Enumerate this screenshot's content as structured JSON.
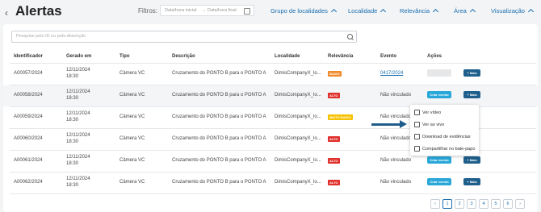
{
  "header": {
    "back_icon": "chevron-left-icon",
    "title": "Alertas",
    "filters_label": "Filtros:",
    "date_start_placeholder": "Data/hora inicial",
    "date_sep": "→",
    "date_end_placeholder": "Data/hora final",
    "filters": [
      "Grupo de localidades",
      "Localidade",
      "Relevância",
      "Área",
      "Visualização"
    ]
  },
  "search": {
    "placeholder": "Pesquise pelo ID ou pela descrição"
  },
  "table": {
    "columns": [
      "Identificador",
      "Gerado em",
      "Tipo",
      "Descrição",
      "Localidade",
      "Relevância",
      "Evento",
      "Ações"
    ],
    "rows": [
      {
        "id": "A00057/2024",
        "date": "12/11/2024",
        "time": "18:30",
        "type": "Câmera VC",
        "desc": "Cruzamento do PONTO B para o PONTO A",
        "loc": "DimisCompanyX_lo...",
        "rel": "BAIXO",
        "event": "0417/2024"
      },
      {
        "id": "A00058/2024",
        "date": "12/11/2024",
        "time": "18:30",
        "type": "Câmera VC",
        "desc": "Cruzamento do PONTO B para o PONTO A",
        "loc": "DimisCompanyX_lo...",
        "rel": "ALTO",
        "event": "Não vinculado"
      },
      {
        "id": "A00059/2024",
        "date": "12/11/2024",
        "time": "18:30",
        "type": "Câmera VC",
        "desc": "Cruzamento do PONTO B para o PONTO A",
        "loc": "DimisCompanyX_lo...",
        "rel": "MUITO BAIXO",
        "event": "Não vinculado"
      },
      {
        "id": "A00060/2024",
        "date": "12/11/2024",
        "time": "18:30",
        "type": "Câmera VC",
        "desc": "Cruzamento do PONTO B para o PONTO A",
        "loc": "DimisCompanyX_lo...",
        "rel": "ALTO",
        "event": "Não vinculado"
      },
      {
        "id": "A00061/2024",
        "date": "12/11/2024",
        "time": "18:30",
        "type": "Câmera VC",
        "desc": "Cruzamento do PONTO B para o PONTO A",
        "loc": "DimisCompanyX_lo...",
        "rel": "ALTO",
        "event": "Não vinculado"
      },
      {
        "id": "A00062/2024",
        "date": "12/11/2024",
        "time": "18:30",
        "type": "Câmera VC",
        "desc": "Cruzamento do PONTO B para o PONTO A",
        "loc": "DimisCompanyX_lo...",
        "rel": "ALTO",
        "event": "Não vinculado"
      }
    ],
    "btn_vincular": "Criar evento",
    "btn_mais": "+ Mais"
  },
  "menu": {
    "items": [
      "Ver vídeo",
      "Ver ao vivo",
      "Download de evidências",
      "Compartilhar no bate-papo"
    ]
  },
  "pagination": {
    "prev": "‹",
    "pages": [
      "1",
      "2",
      "3",
      "4",
      "5",
      "6"
    ],
    "next": "›"
  },
  "colors": {
    "accent": "#1a6fb0",
    "primary_button": "#1e5f8c",
    "link_button": "#29a7d8",
    "alto": "#e0302c",
    "baixo": "#f08a2b",
    "muito_baixo": "#f5c200"
  }
}
